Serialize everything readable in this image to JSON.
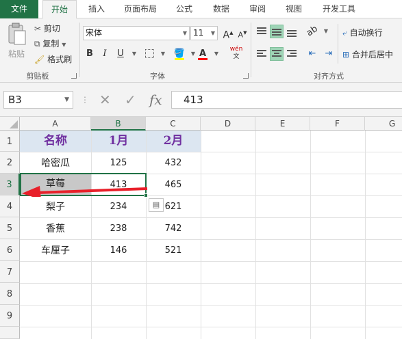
{
  "tabs": [
    "文件",
    "开始",
    "插入",
    "页面布局",
    "公式",
    "数据",
    "审阅",
    "视图",
    "开发工具"
  ],
  "clipboard": {
    "paste": "粘贴",
    "cut": "剪切",
    "copy": "复制",
    "format_painter": "格式刷",
    "group": "剪贴板"
  },
  "font": {
    "name": "宋体",
    "size": "11",
    "group": "字体",
    "grow": "A",
    "shrink": "A",
    "bold": "B",
    "italic": "I",
    "underline": "U",
    "phonetic": "wén"
  },
  "alignment": {
    "wrap_text": "自动换行",
    "merge_center": "合并后居中",
    "group": "对齐方式"
  },
  "formula_bar": {
    "name_box": "B3",
    "fx": "fx",
    "value": "413"
  },
  "columns": [
    "A",
    "B",
    "C",
    "D",
    "E",
    "F",
    "G"
  ],
  "rows": [
    "1",
    "2",
    "3",
    "4",
    "5",
    "6",
    "7",
    "8",
    "9"
  ],
  "table": {
    "header": [
      "名称",
      "1月",
      "2月"
    ],
    "data": [
      [
        "哈密瓜",
        "125",
        "432"
      ],
      [
        "草莓",
        "413",
        "465"
      ],
      [
        "梨子",
        "234",
        "621"
      ],
      [
        "香蕉",
        "238",
        "742"
      ],
      [
        "车厘子",
        "146",
        "521"
      ]
    ]
  },
  "selected_cell": "B3",
  "colors": {
    "accent": "#217346",
    "header_text": "#7030a0",
    "header_fill": "#dce6f1",
    "arrow": "#e8202a",
    "fill_icon": "#ffff00",
    "font_color_icon": "#ff0000"
  }
}
